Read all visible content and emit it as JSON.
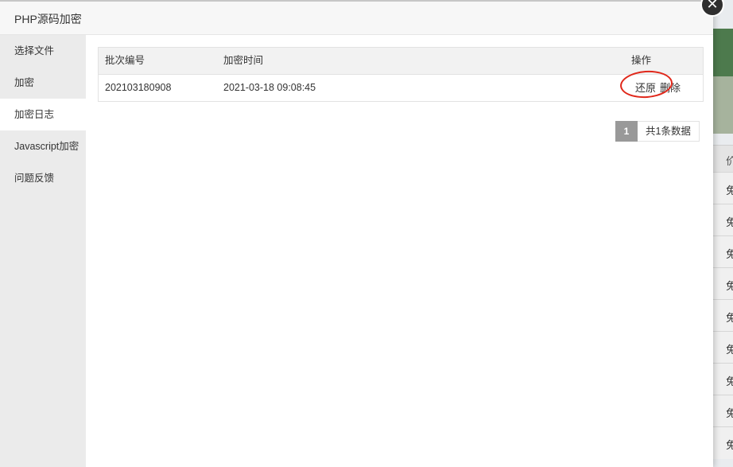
{
  "dialog": {
    "title": "PHP源码加密",
    "close_glyph": "✕"
  },
  "sidebar": {
    "items": [
      {
        "label": "选择文件",
        "active": false
      },
      {
        "label": "加密",
        "active": false
      },
      {
        "label": "加密日志",
        "active": true
      },
      {
        "label": "Javascript加密",
        "active": false
      },
      {
        "label": "问题反馈",
        "active": false
      }
    ]
  },
  "table": {
    "headers": [
      "批次编号",
      "加密时间",
      "操作"
    ],
    "rows": [
      {
        "batch": "202103180908",
        "time": "2021-03-18 09:08:45",
        "restore": "还原",
        "delete": "删除"
      }
    ]
  },
  "pager": {
    "current": "1",
    "total": "共1条数据"
  },
  "background": {
    "header_char": "价",
    "row_char": "免"
  },
  "colors": {
    "highlight_ring": "#e0271a",
    "sidebar_bg": "#ebebeb",
    "pager_active": "#999999"
  }
}
